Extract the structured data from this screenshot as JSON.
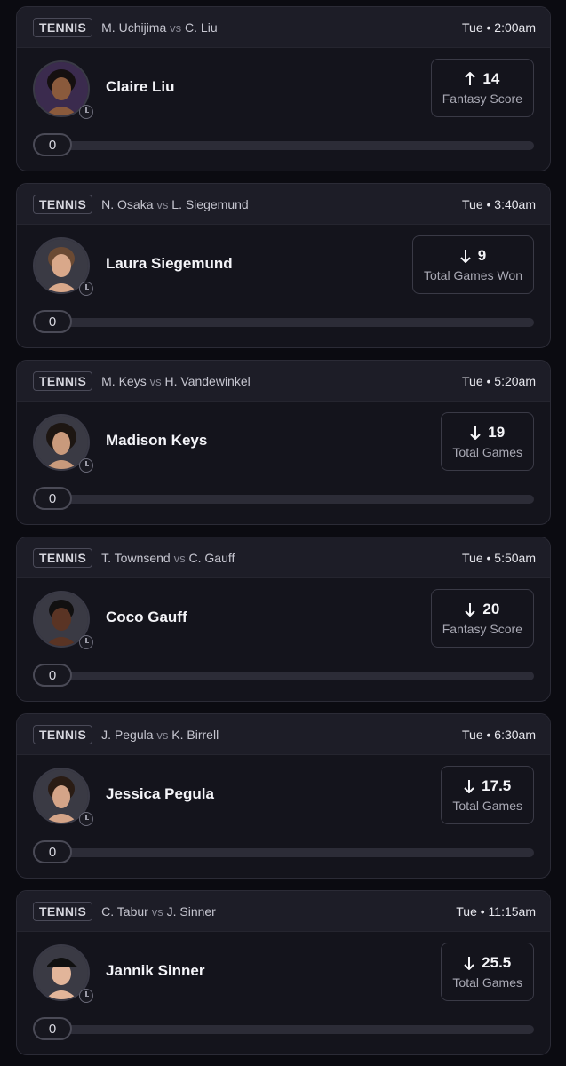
{
  "cards": [
    {
      "sport": "TENNIS",
      "p1": "M. Uchijima",
      "vs": "vs",
      "p2": "C. Liu",
      "time": "Tue • 2:00am",
      "player": "Claire Liu",
      "direction": "up",
      "value": "14",
      "stat": "Fantasy Score",
      "progress": "0",
      "skin": "#8a5a3c",
      "hair": "#151010"
    },
    {
      "sport": "TENNIS",
      "p1": "N. Osaka",
      "vs": "vs",
      "p2": "L. Siegemund",
      "time": "Tue • 3:40am",
      "player": "Laura Siegemund",
      "direction": "down",
      "value": "9",
      "stat": "Total Games Won",
      "progress": "0",
      "skin": "#d9a88a",
      "hair": "#6b4a33"
    },
    {
      "sport": "TENNIS",
      "p1": "M. Keys",
      "vs": "vs",
      "p2": "H. Vandewinkel",
      "time": "Tue • 5:20am",
      "player": "Madison Keys",
      "direction": "down",
      "value": "19",
      "stat": "Total Games",
      "progress": "0",
      "skin": "#c99a7c",
      "hair": "#1d1612"
    },
    {
      "sport": "TENNIS",
      "p1": "T. Townsend",
      "vs": "vs",
      "p2": "C. Gauff",
      "time": "Tue • 5:50am",
      "player": "Coco Gauff",
      "direction": "down",
      "value": "20",
      "stat": "Fantasy Score",
      "progress": "0",
      "skin": "#5a3424",
      "hair": "#111010"
    },
    {
      "sport": "TENNIS",
      "p1": "J. Pegula",
      "vs": "vs",
      "p2": "K. Birrell",
      "time": "Tue • 6:30am",
      "player": "Jessica Pegula",
      "direction": "down",
      "value": "17.5",
      "stat": "Total Games",
      "progress": "0",
      "skin": "#d4a488",
      "hair": "#2a1c14"
    },
    {
      "sport": "TENNIS",
      "p1": "C. Tabur",
      "vs": "vs",
      "p2": "J. Sinner",
      "time": "Tue • 11:15am",
      "player": "Jannik Sinner",
      "direction": "down",
      "value": "25.5",
      "stat": "Total Games",
      "progress": "0",
      "skin": "#e2b59a",
      "hair": "#101010"
    }
  ],
  "icons": {
    "avatar_badge": "clock-icon",
    "up": "arrow-up-icon",
    "down": "arrow-down-icon"
  }
}
